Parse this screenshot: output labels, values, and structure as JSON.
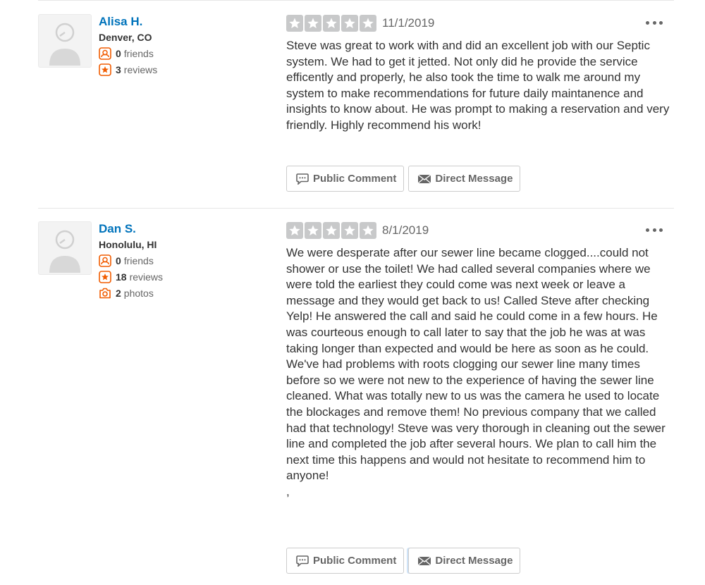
{
  "reviews": [
    {
      "user_name": "Alisa H.",
      "location": "Denver, CO",
      "friends_count": "0",
      "friends_label": "friends",
      "reviews_count": "3",
      "reviews_label": "reviews",
      "rating": 5,
      "date": "11/1/2019",
      "text": "Steve was great to work with and did an excellent job with our Septic system. We had to get it jetted. Not only did he provide the service efficently and properly, he also took the time to walk me around my system to make recommendations for future daily maintanence and insights to know about.  He was prompt to making a reservation and very friendly.  Highly recommend his work!",
      "public_comment_label": "Public Comment",
      "direct_message_label": "Direct Message"
    },
    {
      "user_name": "Dan S.",
      "location": "Honolulu, HI",
      "friends_count": "0",
      "friends_label": "friends",
      "reviews_count": "18",
      "reviews_label": "reviews",
      "photos_count": "2",
      "photos_label": "photos",
      "rating": 5,
      "date": "8/1/2019",
      "text": "We were desperate after our sewer line became clogged....could not shower or use the toilet!  We had called several companies where we were told the earliest they could come was next week or leave a message and they would get back to us!  Called Steve after checking Yelp!  He answered the call and said he could come in a few hours.  He was courteous enough to call later to say that the job he was at was taking longer than expected and would be here as soon as he could.\nWe've had problems with roots clogging our sewer line many times before so we were not new to the experience of having the sewer line cleaned.  What was totally new to us was the camera he used to locate the blockages and remove them!  No previous company that we called had that technology!  Steve was very thorough in cleaning out the sewer line and completed the job after several hours.  We plan to call him the next time this happens and would not hesitate to recommend him to anyone!\n,",
      "public_comment_label": "Public Comment",
      "direct_message_label": "Direct Message"
    }
  ],
  "colors": {
    "user_link": "#0073bb",
    "star_empty": "#c8c9ca",
    "stat_icon": "#f15c00"
  },
  "icons": {
    "avatar": "default-user-avatar-icon",
    "friends": "friends-icon",
    "reviews": "star-review-icon",
    "photos": "camera-icon",
    "comment": "speech-bubble-icon",
    "message": "envelope-icon",
    "more": "ellipsis-icon"
  }
}
